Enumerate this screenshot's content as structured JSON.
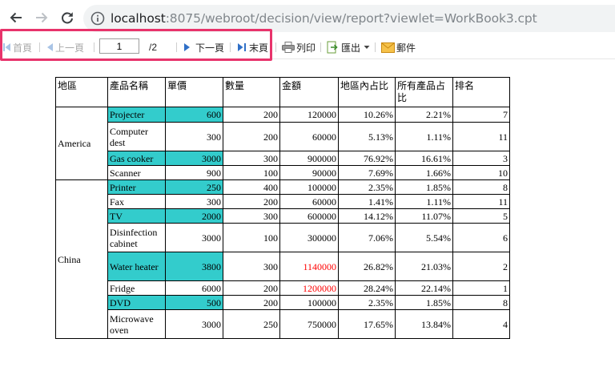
{
  "browser": {
    "url_host": "localhost",
    "url_rest": ":8075/webroot/decision/view/report?viewlet=WorkBook3.cpt"
  },
  "toolbar": {
    "first_label": "首頁",
    "prev_label": "上一頁",
    "page_value": "1",
    "page_total": "/2",
    "next_label": "下一頁",
    "last_label": "末頁",
    "print_label": "列印",
    "export_label": "匯出",
    "mail_label": "郵件",
    "colors": {
      "highlight": "#e8336b",
      "nav_arrow": "#2f6fc7"
    }
  },
  "report": {
    "headers": [
      "地區",
      "產品名稱",
      "單價",
      "數量",
      "金額",
      "地區內占比",
      "所有產品占比",
      "排名"
    ],
    "colors": {
      "highlight": "#33cccc",
      "alert_text": "#ff0000"
    },
    "regions": [
      {
        "name": "America",
        "rows": [
          {
            "product": "Projecter",
            "price": "600",
            "qty": "200",
            "amount": "120000",
            "region_pct": "10.26%",
            "total_pct": "2.21%",
            "rank": "7",
            "highlight": true,
            "amount_red": false
          },
          {
            "product": "Computer dest",
            "price": "300",
            "qty": "200",
            "amount": "60000",
            "region_pct": "5.13%",
            "total_pct": "1.11%",
            "rank": "11",
            "highlight": false,
            "amount_red": false
          },
          {
            "product": "Gas cooker",
            "price": "3000",
            "qty": "300",
            "amount": "900000",
            "region_pct": "76.92%",
            "total_pct": "16.61%",
            "rank": "3",
            "highlight": true,
            "amount_red": false
          },
          {
            "product": "Scanner",
            "price": "900",
            "qty": "100",
            "amount": "90000",
            "region_pct": "7.69%",
            "total_pct": "1.66%",
            "rank": "10",
            "highlight": false,
            "amount_red": false
          }
        ]
      },
      {
        "name": "China",
        "rows": [
          {
            "product": "Printer",
            "price": "250",
            "qty": "400",
            "amount": "100000",
            "region_pct": "2.35%",
            "total_pct": "1.85%",
            "rank": "8",
            "highlight": true,
            "amount_red": false
          },
          {
            "product": "Fax",
            "price": "300",
            "qty": "200",
            "amount": "60000",
            "region_pct": "1.41%",
            "total_pct": "1.11%",
            "rank": "11",
            "highlight": false,
            "amount_red": false
          },
          {
            "product": "TV",
            "price": "2000",
            "qty": "300",
            "amount": "600000",
            "region_pct": "14.12%",
            "total_pct": "11.07%",
            "rank": "5",
            "highlight": true,
            "amount_red": false
          },
          {
            "product": "Disinfection cabinet",
            "price": "3000",
            "qty": "100",
            "amount": "300000",
            "region_pct": "7.06%",
            "total_pct": "5.54%",
            "rank": "6",
            "highlight": false,
            "amount_red": false
          },
          {
            "product": "Water heater",
            "price": "3800",
            "qty": "300",
            "amount": "1140000",
            "region_pct": "26.82%",
            "total_pct": "21.03%",
            "rank": "2",
            "highlight": true,
            "amount_red": true
          },
          {
            "product": "Fridge",
            "price": "6000",
            "qty": "200",
            "amount": "1200000",
            "region_pct": "28.24%",
            "total_pct": "22.14%",
            "rank": "1",
            "highlight": false,
            "amount_red": true
          },
          {
            "product": "DVD",
            "price": "500",
            "qty": "200",
            "amount": "100000",
            "region_pct": "2.35%",
            "total_pct": "1.85%",
            "rank": "8",
            "highlight": true,
            "amount_red": false
          },
          {
            "product": "Microwave oven",
            "price": "3000",
            "qty": "250",
            "amount": "750000",
            "region_pct": "17.65%",
            "total_pct": "13.84%",
            "rank": "4",
            "highlight": false,
            "amount_red": false
          }
        ]
      }
    ]
  }
}
